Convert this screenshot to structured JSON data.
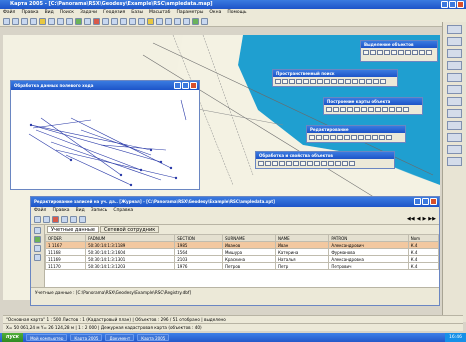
{
  "app": {
    "title": "Карта 2005 - [С:\\Panorama\\RSX\\Geodesy\\Example\\RSC\\ampledata.map]",
    "menu": [
      "Файл",
      "Правка",
      "Вид",
      "Поиск",
      "Задачи",
      "Геодезия",
      "Базы",
      "Масштаб",
      "Параметры",
      "Окна",
      "Помощь"
    ]
  },
  "panels": {
    "p1": "Выделение объектов",
    "p2": "Пространственный поиск",
    "p3": "Построение карты объекта",
    "p4": "Редактирование",
    "p5": "Обработка и свойства объектов"
  },
  "survey_window": {
    "title": "Обработка данных полевого хода"
  },
  "db_window": {
    "title": "Редактирование записей на уч. да.. [Журнал] - [С:\\Panorama\\RSX\\Geodesy\\Example\\RSC\\ampledata.xpt]",
    "menu": [
      "Файл",
      "Правка",
      "Вид",
      "Запись",
      "Справка"
    ],
    "tabs": [
      "Учетные данные",
      "Сетевой сотрудник"
    ],
    "columns": [
      "OFDER",
      "FADNUM",
      "SECTION",
      "SURNAME",
      "NAME",
      "PATRON",
      "Nom"
    ],
    "rows": [
      [
        "1 1167",
        "50:30:14:1:3:1189",
        "1985",
        "Иванов",
        "Иван",
        "Александрович",
        "К.4"
      ],
      [
        "11168",
        "50:30:14:1:3:1604",
        "1564",
        "Мишура",
        "Катерина",
        "Фурманова",
        "К.4"
      ],
      [
        "11169",
        "50:30:14:1:3:1301",
        "2103",
        "Краскина",
        "Наталья",
        "Александровна",
        "К.4"
      ],
      [
        "11170",
        "50:30:14:1:3:1203",
        "1976",
        "Петров",
        "Петр",
        "Петрович",
        "К.4"
      ]
    ],
    "footer": "Учетные данные : [С:\\Panorama\\RSX\\Geodesy\\Example\\RSC\\Registry.dbf]"
  },
  "status": {
    "line1": "\"Основная карта\"  1 : 500  Листов : 1  (Кадастровый план)  |  Объектов : 296 / 51  отобрано  |  выделено",
    "line2": "X= 50 061,24 м   Y= 26 124,28 м   |   1 : 2 000   |   Дежурная кадастровая карта   (объектов : 40)"
  },
  "taskbar": {
    "start": "пуск",
    "items": [
      "Мой компьютер",
      "Карта 2005",
      "Документ",
      "Карта 2005"
    ],
    "time": "16:46"
  },
  "colors": {
    "water": "#1f9fd0",
    "map_bg": "#f3f1e2",
    "xp_blue": "#2a64d4"
  }
}
